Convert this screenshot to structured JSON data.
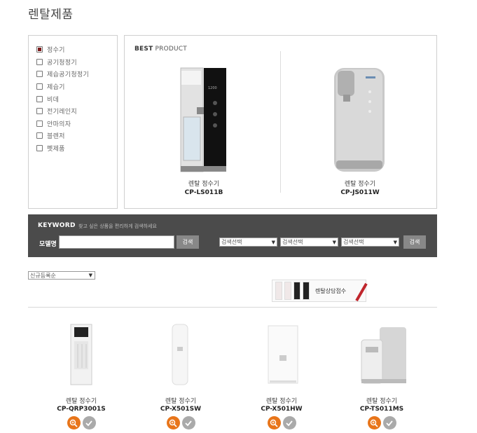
{
  "page": {
    "title": "렌탈제품"
  },
  "categories": [
    {
      "label": "정수기",
      "checked": true
    },
    {
      "label": "공기청정기",
      "checked": false
    },
    {
      "label": "제습공기청정기",
      "checked": false
    },
    {
      "label": "제습기",
      "checked": false
    },
    {
      "label": "비데",
      "checked": false
    },
    {
      "label": "전기레인지",
      "checked": false
    },
    {
      "label": "안마의자",
      "checked": false
    },
    {
      "label": "블렌저",
      "checked": false
    },
    {
      "label": "펫제품",
      "checked": false
    }
  ],
  "best": {
    "title_bold": "BEST",
    "title_rest": " PRODUCT",
    "items": [
      {
        "category": "렌탈 정수기",
        "model": "CP-LS011B"
      },
      {
        "category": "렌탈 정수기",
        "model": "CP-JS011W"
      }
    ]
  },
  "keyword": {
    "label": "KEYWORD",
    "hint": "찾고 싶은 상품을 편리하게 검색하세요",
    "model_label": "모델명",
    "search_label": "검색",
    "selects": [
      "검색선택",
      "검색선택",
      "검색선택"
    ]
  },
  "sort": {
    "selected": "신규등록순"
  },
  "consult": {
    "text": "렌탈상담접수"
  },
  "products": [
    {
      "category": "렌탈 정수기",
      "model": "CP-QRP3001S"
    },
    {
      "category": "렌탈 정수기",
      "model": "CP-X501SW"
    },
    {
      "category": "렌탈 정수기",
      "model": "CP-X501HW"
    },
    {
      "category": "렌탈 정수기",
      "model": "CP-TS011MS"
    }
  ],
  "colors": {
    "accent": "#e8751a",
    "check_gray": "#aaaaaa",
    "keyword_bar": "#4b4b4b",
    "checkbox_fill": "#7b1a1a"
  },
  "icons": {
    "zoom": "zoom-in-icon",
    "check": "check-icon",
    "dropdown": "chevron-down-icon"
  }
}
